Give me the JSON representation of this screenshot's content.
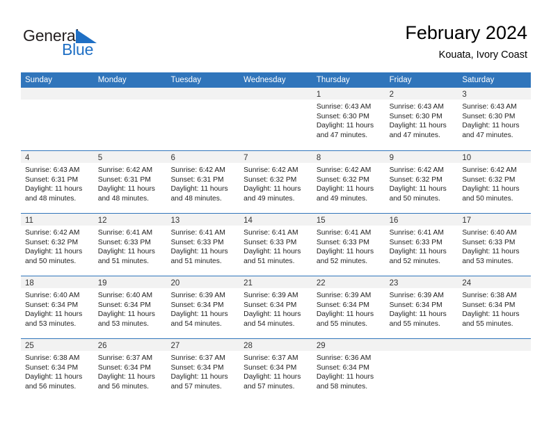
{
  "brand": {
    "name_part1": "General",
    "name_part2": "Blue",
    "logo_icon": "triangle-flag-icon",
    "color_primary": "#3075bb",
    "color_text": "#231f20"
  },
  "header": {
    "title": "February 2024",
    "subtitle": "Kouata, Ivory Coast"
  },
  "calendar": {
    "weekdays": [
      "Sunday",
      "Monday",
      "Tuesday",
      "Wednesday",
      "Thursday",
      "Friday",
      "Saturday"
    ],
    "header_bg": "#3075bb",
    "daynum_bg": "#f2f2f2",
    "weeks": [
      [
        {
          "day": "",
          "lines": []
        },
        {
          "day": "",
          "lines": []
        },
        {
          "day": "",
          "lines": []
        },
        {
          "day": "",
          "lines": []
        },
        {
          "day": "1",
          "lines": [
            "Sunrise: 6:43 AM",
            "Sunset: 6:30 PM",
            "Daylight: 11 hours",
            "and 47 minutes."
          ]
        },
        {
          "day": "2",
          "lines": [
            "Sunrise: 6:43 AM",
            "Sunset: 6:30 PM",
            "Daylight: 11 hours",
            "and 47 minutes."
          ]
        },
        {
          "day": "3",
          "lines": [
            "Sunrise: 6:43 AM",
            "Sunset: 6:30 PM",
            "Daylight: 11 hours",
            "and 47 minutes."
          ]
        }
      ],
      [
        {
          "day": "4",
          "lines": [
            "Sunrise: 6:43 AM",
            "Sunset: 6:31 PM",
            "Daylight: 11 hours",
            "and 48 minutes."
          ]
        },
        {
          "day": "5",
          "lines": [
            "Sunrise: 6:42 AM",
            "Sunset: 6:31 PM",
            "Daylight: 11 hours",
            "and 48 minutes."
          ]
        },
        {
          "day": "6",
          "lines": [
            "Sunrise: 6:42 AM",
            "Sunset: 6:31 PM",
            "Daylight: 11 hours",
            "and 48 minutes."
          ]
        },
        {
          "day": "7",
          "lines": [
            "Sunrise: 6:42 AM",
            "Sunset: 6:32 PM",
            "Daylight: 11 hours",
            "and 49 minutes."
          ]
        },
        {
          "day": "8",
          "lines": [
            "Sunrise: 6:42 AM",
            "Sunset: 6:32 PM",
            "Daylight: 11 hours",
            "and 49 minutes."
          ]
        },
        {
          "day": "9",
          "lines": [
            "Sunrise: 6:42 AM",
            "Sunset: 6:32 PM",
            "Daylight: 11 hours",
            "and 50 minutes."
          ]
        },
        {
          "day": "10",
          "lines": [
            "Sunrise: 6:42 AM",
            "Sunset: 6:32 PM",
            "Daylight: 11 hours",
            "and 50 minutes."
          ]
        }
      ],
      [
        {
          "day": "11",
          "lines": [
            "Sunrise: 6:42 AM",
            "Sunset: 6:32 PM",
            "Daylight: 11 hours",
            "and 50 minutes."
          ]
        },
        {
          "day": "12",
          "lines": [
            "Sunrise: 6:41 AM",
            "Sunset: 6:33 PM",
            "Daylight: 11 hours",
            "and 51 minutes."
          ]
        },
        {
          "day": "13",
          "lines": [
            "Sunrise: 6:41 AM",
            "Sunset: 6:33 PM",
            "Daylight: 11 hours",
            "and 51 minutes."
          ]
        },
        {
          "day": "14",
          "lines": [
            "Sunrise: 6:41 AM",
            "Sunset: 6:33 PM",
            "Daylight: 11 hours",
            "and 51 minutes."
          ]
        },
        {
          "day": "15",
          "lines": [
            "Sunrise: 6:41 AM",
            "Sunset: 6:33 PM",
            "Daylight: 11 hours",
            "and 52 minutes."
          ]
        },
        {
          "day": "16",
          "lines": [
            "Sunrise: 6:41 AM",
            "Sunset: 6:33 PM",
            "Daylight: 11 hours",
            "and 52 minutes."
          ]
        },
        {
          "day": "17",
          "lines": [
            "Sunrise: 6:40 AM",
            "Sunset: 6:33 PM",
            "Daylight: 11 hours",
            "and 53 minutes."
          ]
        }
      ],
      [
        {
          "day": "18",
          "lines": [
            "Sunrise: 6:40 AM",
            "Sunset: 6:34 PM",
            "Daylight: 11 hours",
            "and 53 minutes."
          ]
        },
        {
          "day": "19",
          "lines": [
            "Sunrise: 6:40 AM",
            "Sunset: 6:34 PM",
            "Daylight: 11 hours",
            "and 53 minutes."
          ]
        },
        {
          "day": "20",
          "lines": [
            "Sunrise: 6:39 AM",
            "Sunset: 6:34 PM",
            "Daylight: 11 hours",
            "and 54 minutes."
          ]
        },
        {
          "day": "21",
          "lines": [
            "Sunrise: 6:39 AM",
            "Sunset: 6:34 PM",
            "Daylight: 11 hours",
            "and 54 minutes."
          ]
        },
        {
          "day": "22",
          "lines": [
            "Sunrise: 6:39 AM",
            "Sunset: 6:34 PM",
            "Daylight: 11 hours",
            "and 55 minutes."
          ]
        },
        {
          "day": "23",
          "lines": [
            "Sunrise: 6:39 AM",
            "Sunset: 6:34 PM",
            "Daylight: 11 hours",
            "and 55 minutes."
          ]
        },
        {
          "day": "24",
          "lines": [
            "Sunrise: 6:38 AM",
            "Sunset: 6:34 PM",
            "Daylight: 11 hours",
            "and 55 minutes."
          ]
        }
      ],
      [
        {
          "day": "25",
          "lines": [
            "Sunrise: 6:38 AM",
            "Sunset: 6:34 PM",
            "Daylight: 11 hours",
            "and 56 minutes."
          ]
        },
        {
          "day": "26",
          "lines": [
            "Sunrise: 6:37 AM",
            "Sunset: 6:34 PM",
            "Daylight: 11 hours",
            "and 56 minutes."
          ]
        },
        {
          "day": "27",
          "lines": [
            "Sunrise: 6:37 AM",
            "Sunset: 6:34 PM",
            "Daylight: 11 hours",
            "and 57 minutes."
          ]
        },
        {
          "day": "28",
          "lines": [
            "Sunrise: 6:37 AM",
            "Sunset: 6:34 PM",
            "Daylight: 11 hours",
            "and 57 minutes."
          ]
        },
        {
          "day": "29",
          "lines": [
            "Sunrise: 6:36 AM",
            "Sunset: 6:34 PM",
            "Daylight: 11 hours",
            "and 58 minutes."
          ]
        },
        {
          "day": "",
          "lines": []
        },
        {
          "day": "",
          "lines": []
        }
      ]
    ]
  }
}
